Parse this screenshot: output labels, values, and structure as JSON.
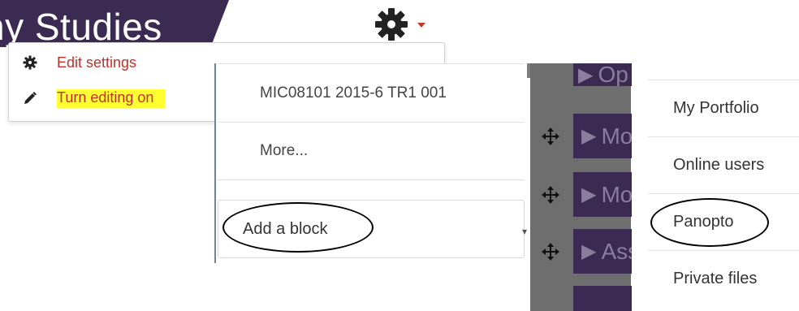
{
  "banner": {
    "title": "ny Studies"
  },
  "settings_menu": {
    "items": [
      {
        "label": "Edit settings",
        "icon": "gear-icon"
      },
      {
        "label": "Turn editing on",
        "icon": "pencil-icon",
        "highlight": "#ffff33"
      }
    ]
  },
  "course_panel": {
    "rows": [
      {
        "label": "MIC08101 2015-6 TR1 001"
      },
      {
        "label": "More..."
      }
    ],
    "add_block": {
      "label": "Add a block"
    }
  },
  "modules": {
    "tiles": [
      {
        "label": "Op"
      },
      {
        "label": "Mo"
      },
      {
        "label": "Mo"
      },
      {
        "label": "Ass"
      },
      {
        "label": ""
      }
    ]
  },
  "nav_list": {
    "items": [
      {
        "label": "My Portfolio"
      },
      {
        "label": "Online users"
      },
      {
        "label": "Panopto"
      },
      {
        "label": "Private files"
      }
    ]
  },
  "colors": {
    "brand_purple": "#3b2a52",
    "menu_text_red": "#c0312b",
    "highlight_yellow": "#ffff33",
    "dark_gray": "#6e6e6e"
  }
}
